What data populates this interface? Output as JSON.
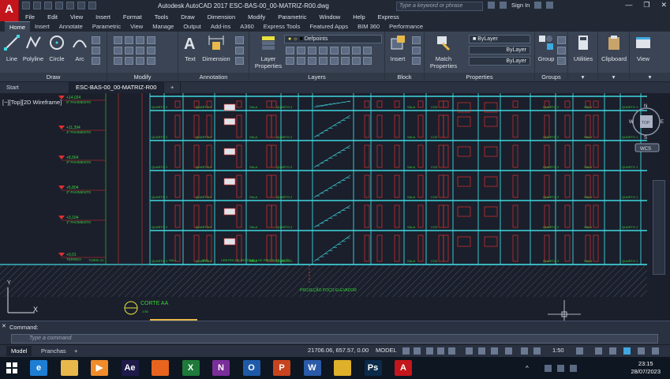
{
  "titlebar": {
    "title": "Autodesk AutoCAD 2017    ESC-BAS-00_00-MATRIZ-R00.dwg",
    "search_placeholder": "Type a keyword or phrase",
    "signin": "Sign In",
    "app_letter": "A"
  },
  "menu": [
    "File",
    "Edit",
    "View",
    "Insert",
    "Format",
    "Tools",
    "Draw",
    "Dimension",
    "Modify",
    "Parametric",
    "Window",
    "Help",
    "Express"
  ],
  "ribbon_tabs": [
    "Home",
    "Insert",
    "Annotate",
    "Parametric",
    "View",
    "Manage",
    "Output",
    "Add-ins",
    "A360",
    "Express Tools",
    "Featured Apps",
    "BIM 360",
    "Performance"
  ],
  "ribbon": {
    "draw": {
      "title": "Draw",
      "line": "Line",
      "polyline": "Polyline",
      "circle": "Circle",
      "arc": "Arc"
    },
    "modify": {
      "title": "Modify"
    },
    "annotation": {
      "title": "Annotation",
      "text": "Text",
      "dimension": "Dimension"
    },
    "layers": {
      "title": "Layers",
      "layer_properties": "Layer Properties",
      "current_layer": "Defpoints"
    },
    "block": {
      "title": "Block",
      "insert": "Insert"
    },
    "properties": {
      "title": "Properties",
      "match_properties": "Match Properties",
      "color": "ByLayer",
      "linetype": "ByLayer",
      "lineweight": "ByLayer"
    },
    "groups": {
      "title": "Groups",
      "group": "Group"
    },
    "utilities": "Utilities",
    "clipboard": "Clipboard",
    "view": "View"
  },
  "file_tabs": {
    "start": "Start",
    "current": "ESC-BAS-00_00-MATRIZ-R00"
  },
  "viewport": {
    "label": "[−][Top][2D Wireframe]",
    "viewcube": {
      "north": "N",
      "south": "S",
      "east": "E",
      "west": "W",
      "top": "TOP",
      "wcs": "WCS"
    },
    "levels": [
      {
        "elev": "+14,024",
        "name": "5º PAVIMENTO"
      },
      {
        "elev": "+11,394",
        "name": "4º PAVIMENTO"
      },
      {
        "elev": "+8,564",
        "name": "3º PAVIMENTO"
      },
      {
        "elev": "+5,804",
        "name": "2º PAVIMENTO"
      },
      {
        "elev": "+3,104",
        "name": "1º PAVIMENTO"
      },
      {
        "elev": "+0,01",
        "name": "TÉRREO"
      }
    ],
    "room_labels": [
      "QUARTO 2",
      "QUARTO 1",
      "SALA",
      "QUARTO 2",
      "SALA",
      "COZ",
      "QUARTO 2",
      "SALA",
      "QUARTO 1"
    ],
    "ground_labels": [
      "TORRE 01",
      "HALL",
      "W.C.",
      "CENTRO DE RESÍDUO",
      "SALA DE PRESSURIZAÇÃO"
    ],
    "elevator_note": "PROJEÇÃO POÇO ELEVADOR",
    "section_label": "CORTE AA",
    "section_scale": "1:50",
    "axis_y": "Y",
    "axis_x": "X"
  },
  "command": {
    "label": "Command:",
    "placeholder": "Type a command"
  },
  "status": {
    "tabs": [
      "Model",
      "Pranchas"
    ],
    "coords": "21706.06, 657.57, 0.00",
    "model": "MODEL",
    "scale": "1:50"
  },
  "taskbar": {
    "apps": [
      {
        "name": "internet-explorer",
        "letter": "e",
        "color": "#1e7ed4"
      },
      {
        "name": "file-explorer",
        "letter": "",
        "color": "#e8b84a"
      },
      {
        "name": "media-player",
        "letter": "▶",
        "color": "#f08c2a"
      },
      {
        "name": "after-effects",
        "letter": "Ae",
        "color": "#1e1b4a"
      },
      {
        "name": "firefox",
        "letter": "",
        "color": "#e8641e"
      },
      {
        "name": "excel",
        "letter": "X",
        "color": "#1e7a3a"
      },
      {
        "name": "onenote",
        "letter": "N",
        "color": "#7a2e9a"
      },
      {
        "name": "outlook",
        "letter": "O",
        "color": "#1e5aa8"
      },
      {
        "name": "powerpoint",
        "letter": "P",
        "color": "#c8441e"
      },
      {
        "name": "word",
        "letter": "W",
        "color": "#2a5aa8"
      },
      {
        "name": "chrome",
        "letter": "",
        "color": "#dfb02a"
      },
      {
        "name": "photoshop",
        "letter": "Ps",
        "color": "#0c2a4a"
      },
      {
        "name": "autocad",
        "letter": "A",
        "color": "#c3161c"
      }
    ],
    "time": "23:15",
    "date": "28/07/2023"
  },
  "colors": {
    "accent": "#c3161c",
    "cyan": "#40d8e0",
    "green": "#3ad13a",
    "red": "#e03030",
    "yellow": "#e8e040"
  }
}
